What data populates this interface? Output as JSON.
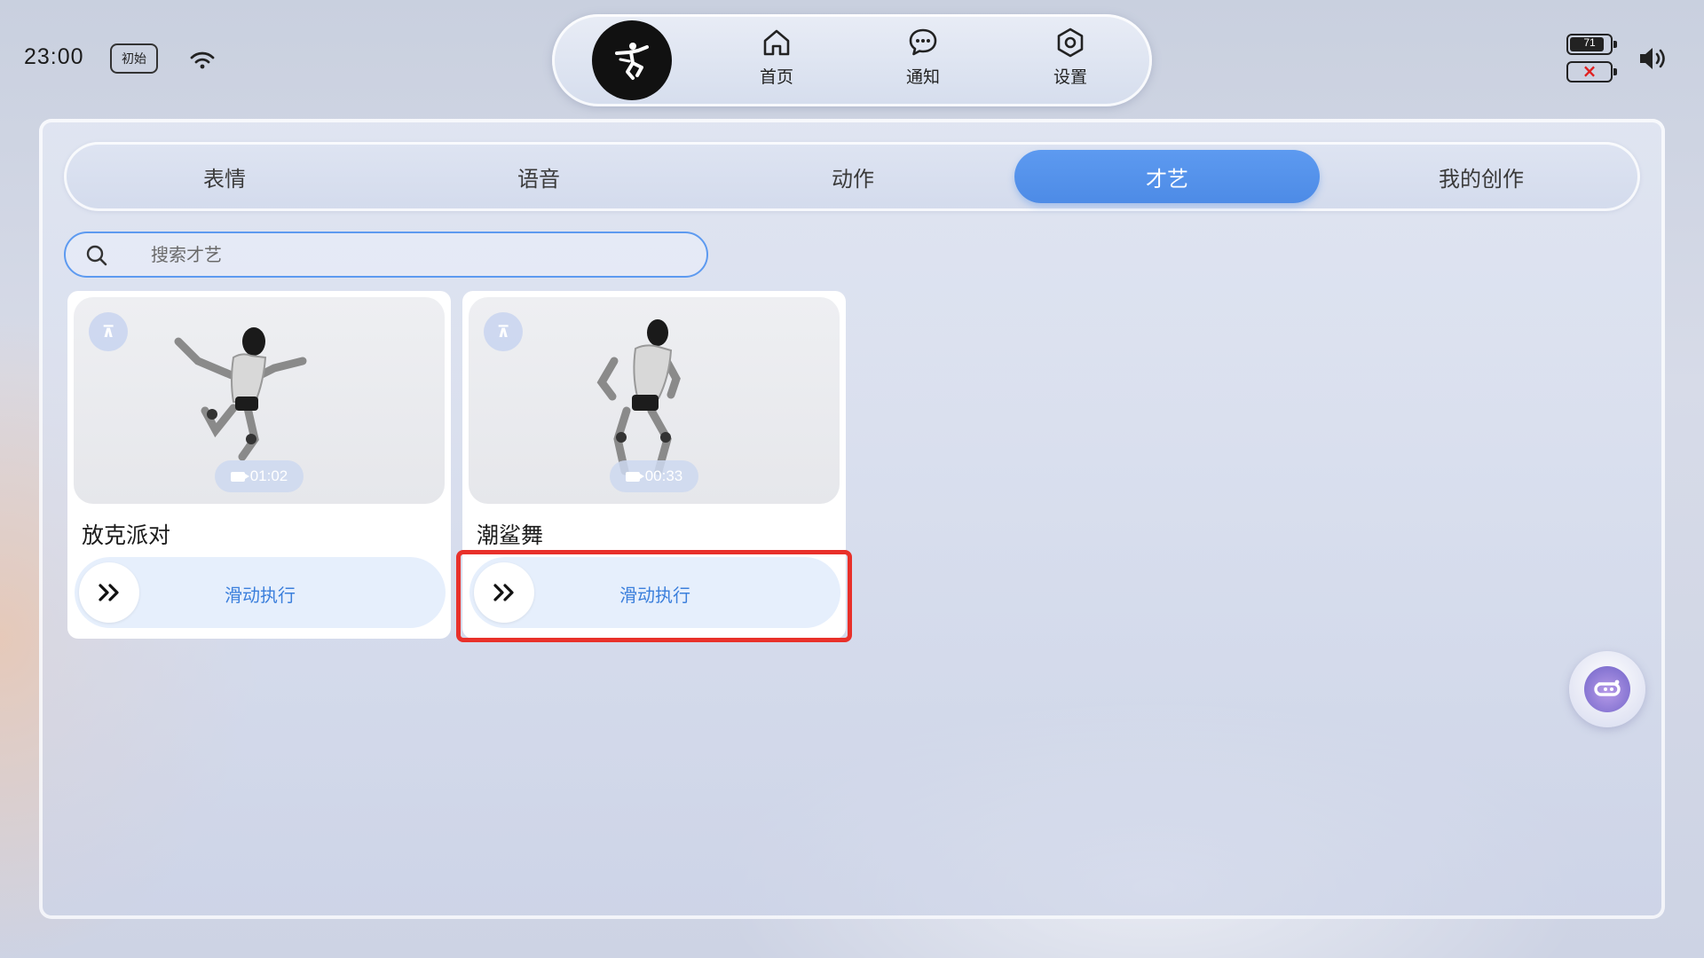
{
  "status_bar": {
    "time": "23:00",
    "mode": "初始",
    "battery_1_percent": "71",
    "battery_2_status": "×"
  },
  "top_nav": {
    "items": [
      {
        "label": "首页",
        "icon": "home-icon"
      },
      {
        "label": "通知",
        "icon": "chat-icon"
      },
      {
        "label": "设置",
        "icon": "settings-icon"
      }
    ]
  },
  "tabs": [
    {
      "label": "表情",
      "active": false
    },
    {
      "label": "语音",
      "active": false
    },
    {
      "label": "动作",
      "active": false
    },
    {
      "label": "才艺",
      "active": true
    },
    {
      "label": "我的创作",
      "active": false
    }
  ],
  "search": {
    "placeholder": "搜索才艺",
    "value": ""
  },
  "cards": [
    {
      "title": "放克派对",
      "duration": "01:02",
      "action": "滑动执行"
    },
    {
      "title": "潮鲨舞",
      "duration": "00:33",
      "action": "滑动执行"
    }
  ],
  "colors": {
    "accent": "#5d9af0",
    "highlight": "#e8302a"
  }
}
